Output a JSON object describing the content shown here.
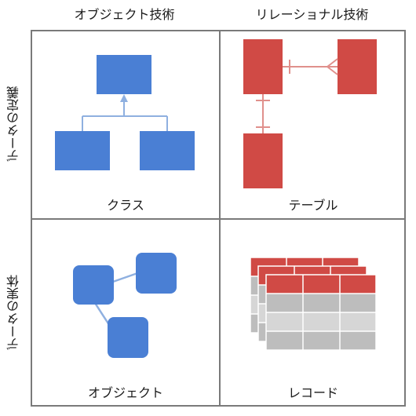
{
  "columns": {
    "object": "オブジェクト技術",
    "relational": "リレーショナル技術"
  },
  "rows": {
    "definition": "データの定義",
    "instance": "データの実体"
  },
  "cells": {
    "class": "クラス",
    "table": "テーブル",
    "object": "オブジェクト",
    "record": "レコード"
  },
  "colors": {
    "blue": "#4a7fd4",
    "blue_line": "#8fb0e0",
    "red": "#d04a45",
    "red_line": "#e0908c",
    "gray_row": "#bdbdbd",
    "gray_row_alt": "#d6d6d6",
    "border": "#7a7a7a"
  }
}
